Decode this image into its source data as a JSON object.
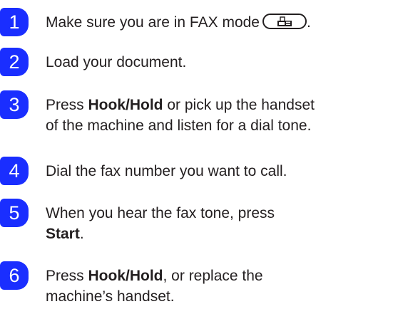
{
  "steps": [
    {
      "number": "1",
      "text": "Make sure you are in FAX mode",
      "icon": "fax-mode-icon",
      "after_icon": "."
    },
    {
      "number": "2",
      "text": "Load your document."
    },
    {
      "number": "3",
      "pre": "Press ",
      "bold": "Hook/Hold",
      "post": " or pick up the handset",
      "line2": "of the machine and listen for a dial tone."
    },
    {
      "number": "4",
      "text": "Dial the fax number you want to call."
    },
    {
      "number": "5",
      "line1": "When you hear the fax tone, press",
      "bold": "Start",
      "post": "."
    },
    {
      "number": "6",
      "pre": "Press ",
      "bold": "Hook/Hold",
      "post": ", or replace the",
      "line2": "machine’s handset."
    }
  ],
  "colors": {
    "badge": "#1a2eff",
    "text": "#231f20"
  }
}
